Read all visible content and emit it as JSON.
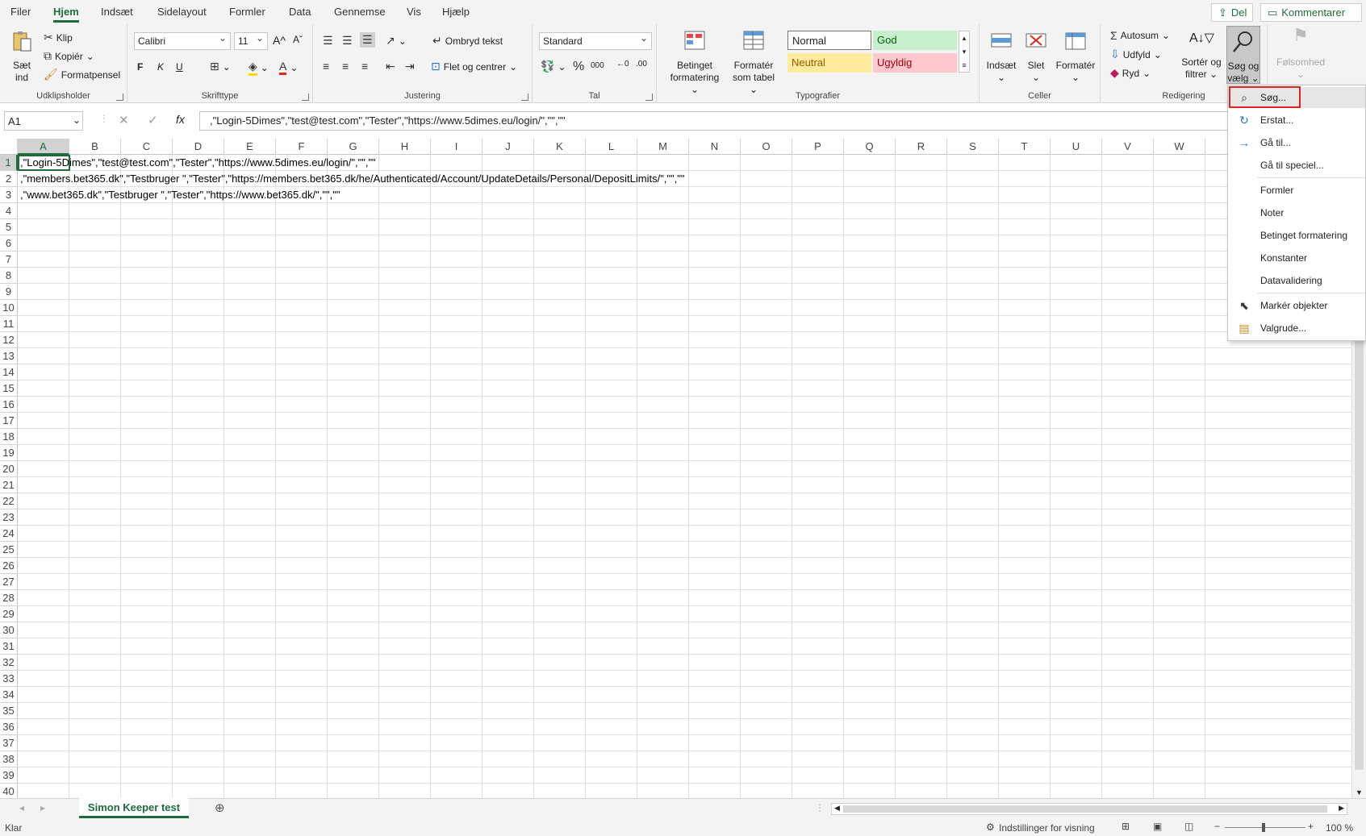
{
  "menu": {
    "tabs": [
      "Filer",
      "Hjem",
      "Indsæt",
      "Sidelayout",
      "Formler",
      "Data",
      "Gennemse",
      "Vis",
      "Hjælp"
    ],
    "share": "Del",
    "comments": "Kommentarer"
  },
  "ribbon": {
    "clipboard": {
      "paste": "Sæt",
      "paste2": "ind",
      "cut": "Klip",
      "copy": "Kopiér",
      "painter": "Formatpensel",
      "label": "Udklipsholder"
    },
    "font": {
      "name": "Calibri",
      "size": "11",
      "bold": "F",
      "italic": "K",
      "underline": "U",
      "label": "Skrifttype"
    },
    "alignment": {
      "wrap": "Ombryd tekst",
      "merge": "Flet og centrer",
      "label": "Justering"
    },
    "number": {
      "format": "Standard",
      "label": "Tal"
    },
    "styles": {
      "cond1": "Betinget",
      "cond2": "formatering",
      "table1": "Formatér",
      "table2": "som tabel",
      "normal": "Normal",
      "good": "God",
      "neutral": "Neutral",
      "bad": "Ugyldig",
      "label": "Typografier"
    },
    "cells": {
      "insert": "Indsæt",
      "delete": "Slet",
      "format": "Formatér",
      "label": "Celler"
    },
    "editing": {
      "autosum": "Autosum",
      "fill": "Udfyld",
      "clear": "Ryd",
      "sort1": "Sortér og",
      "sort2": "filtrer",
      "find1": "Søg og",
      "find2": "vælg",
      "label": "Redigering"
    },
    "sensitivity": "Følsomhed"
  },
  "formula": {
    "namebox": "A1",
    "value": ",\"Login-5Dimes\",\"test@test.com\",\"Tester\",\"https://www.5dimes.eu/login/\",\"\",\"\""
  },
  "grid": {
    "columns": [
      "A",
      "B",
      "C",
      "D",
      "E",
      "F",
      "G",
      "H",
      "I",
      "J",
      "K",
      "L",
      "M",
      "N",
      "O",
      "P",
      "Q",
      "R",
      "S",
      "T",
      "U",
      "V",
      "W"
    ],
    "rows_count": 40,
    "cells": [
      ",\"Login-5Dimes\",\"test@test.com\",\"Tester\",\"https://www.5dimes.eu/login/\",\"\",\"\"",
      ",\"members.bet365.dk\",\"Testbruger \",\"Tester\",\"https://members.bet365.dk/he/Authenticated/Account/UpdateDetails/Personal/DepositLimits/\",\"\",\"\"",
      ",\"www.bet365.dk\",\"Testbruger \",\"Tester\",\"https://www.bet365.dk/\",\"\",\"\""
    ]
  },
  "sheet": {
    "tab": "Simon Keeper test"
  },
  "status": {
    "ready": "Klar",
    "display": "Indstillinger for visning",
    "zoom": "100 %"
  },
  "dropdown": {
    "items": [
      "Søg...",
      "Erstat...",
      "Gå til...",
      "Gå til speciel...",
      "Formler",
      "Noter",
      "Betinget formatering",
      "Konstanter",
      "Datavalidering",
      "Markér objekter",
      "Valgrude..."
    ]
  },
  "colors": {
    "accent": "#1e6b3b",
    "highlight": "#e02424"
  }
}
